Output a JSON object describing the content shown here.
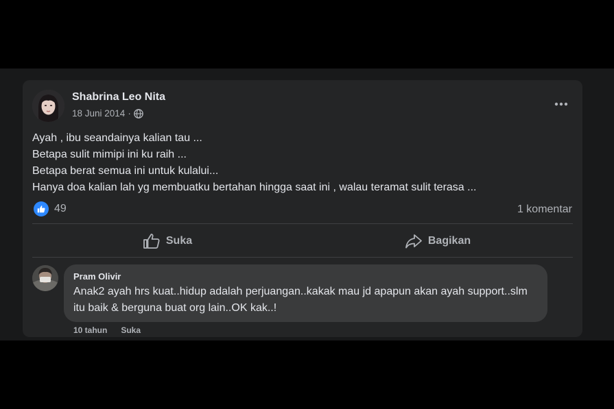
{
  "post": {
    "author": "Shabrina Leo Nita",
    "date": "18 Juni 2014",
    "separator": "·",
    "privacy_icon": "globe-icon",
    "menu_icon": "more-horizontal-icon",
    "lines": [
      "Ayah , ibu seandainya kalian tau ...",
      "Betapa sulit mimipi ini ku raih ...",
      "Betapa berat semua ini untuk kulalui...",
      "Hanya doa kalian lah yg membuatku bertahan hingga saat ini , walau teramat sulit terasa ..."
    ],
    "reaction_icon": "like-icon",
    "reaction_count": "49",
    "comment_count": "1 komentar"
  },
  "actions": {
    "like_label": "Suka",
    "like_icon": "thumbs-up-icon",
    "share_label": "Bagikan",
    "share_icon": "share-arrow-icon"
  },
  "comment": {
    "author": "Pram Olivir",
    "text": "Anak2 ayah hrs kuat..hidup adalah perjuangan..kakak mau jd apapun akan ayah support..slm itu baik & berguna buat org lain..OK kak..!",
    "time": "10 tahun",
    "like_label": "Suka"
  },
  "colors": {
    "page_bg": "#000000",
    "feed_bg": "#18191a",
    "card_bg": "#242526",
    "bubble_bg": "#3a3b3c",
    "primary_text": "#e4e6eb",
    "secondary_text": "#b0b3b8",
    "like_blue": "#2d88ff"
  }
}
